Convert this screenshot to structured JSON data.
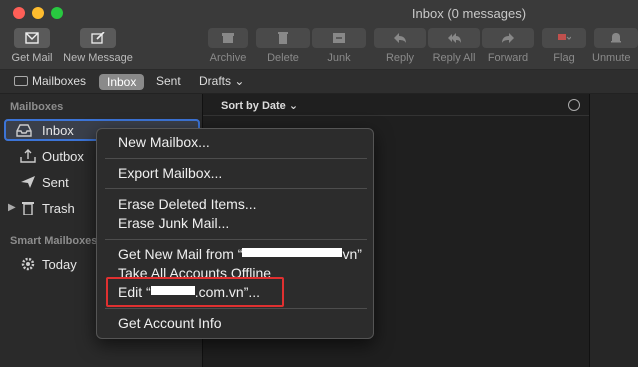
{
  "window": {
    "title": "Inbox (0 messages)"
  },
  "toolbar": {
    "get_mail": "Get Mail",
    "new_message": "New Message",
    "archive": "Archive",
    "delete": "Delete",
    "junk": "Junk",
    "reply": "Reply",
    "reply_all": "Reply All",
    "forward": "Forward",
    "flag": "Flag",
    "unmute": "Unmute"
  },
  "favorites": {
    "mailboxes": "Mailboxes",
    "inbox": "Inbox",
    "sent": "Sent",
    "drafts": "Drafts ⌄"
  },
  "sidebar": {
    "mailboxes_title": "Mailboxes",
    "items": [
      {
        "label": "Inbox"
      },
      {
        "label": "Outbox"
      },
      {
        "label": "Sent"
      },
      {
        "label": "Trash"
      }
    ],
    "smart_title": "Smart Mailboxes",
    "smart_items": [
      {
        "label": "Today"
      }
    ]
  },
  "message_list": {
    "sort_label": "Sort by Date ⌄"
  },
  "context_menu": {
    "new_mailbox": "New Mailbox...",
    "export_mailbox": "Export Mailbox...",
    "erase_deleted": "Erase Deleted Items...",
    "erase_junk": "Erase Junk Mail...",
    "get_new_mail_prefix": "Get New Mail from “",
    "get_new_mail_suffix": "vn”",
    "take_offline": "Take All Accounts Offline",
    "edit_prefix": "Edit “",
    "edit_suffix": ".com.vn”...",
    "get_account_info": "Get Account Info"
  },
  "colors": {
    "highlight": "#e03030",
    "selection": "#3c74d6"
  }
}
